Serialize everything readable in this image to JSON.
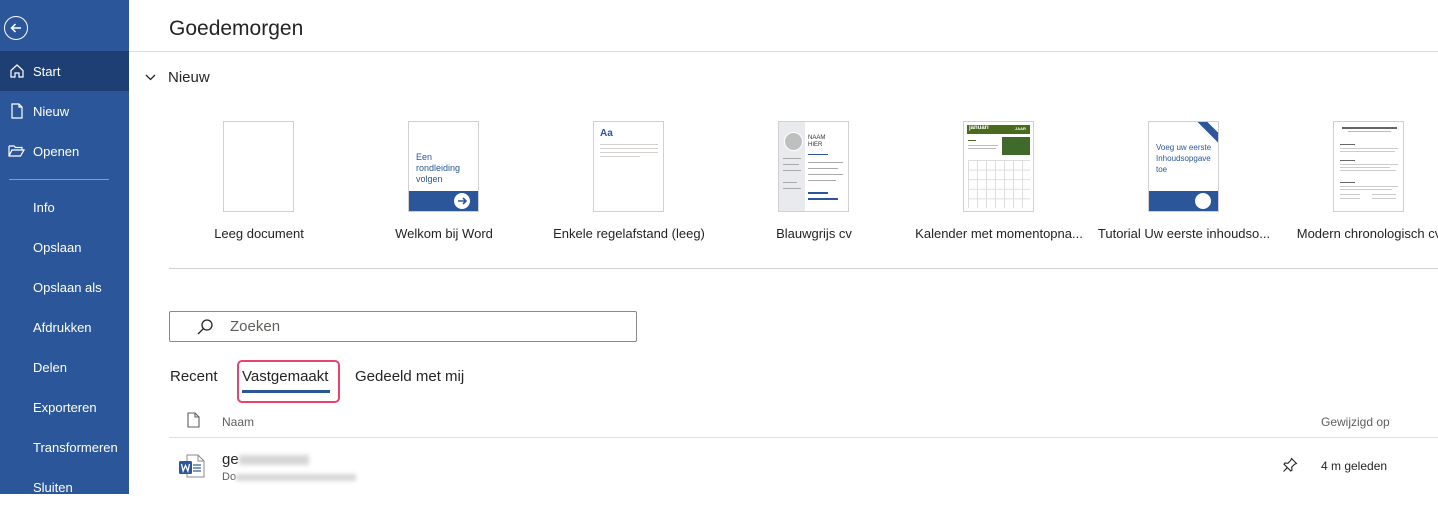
{
  "sidebar": {
    "items": [
      {
        "label": "Start",
        "icon": "home-icon"
      },
      {
        "label": "Nieuw",
        "icon": "new-document-icon"
      },
      {
        "label": "Openen",
        "icon": "folder-open-icon"
      },
      {
        "label": "Info"
      },
      {
        "label": "Opslaan"
      },
      {
        "label": "Opslaan als"
      },
      {
        "label": "Afdrukken"
      },
      {
        "label": "Delen"
      },
      {
        "label": "Exporteren"
      },
      {
        "label": "Transformeren"
      },
      {
        "label": "Sluiten"
      }
    ],
    "accent": "#2b579a",
    "active_bg": "#1e3f73"
  },
  "greeting": "Goedemorgen",
  "new_section": {
    "title": "Nieuw",
    "templates": [
      {
        "label": "Leeg document"
      },
      {
        "label": "Welkom bij Word",
        "thumb_text": "Een rondleiding volgen"
      },
      {
        "label": "Enkele regelafstand (leeg)",
        "thumb_text": "Aa"
      },
      {
        "label": "Blauwgrijs cv",
        "thumb_text": "NAAM HIER"
      },
      {
        "label": "Kalender met momentopna...",
        "thumb_text": "januari",
        "thumb_text2": "JAAR"
      },
      {
        "label": "Tutorial Uw eerste inhoudso...",
        "thumb_text": "Voeg uw eerste Inhoudsopgave toe"
      },
      {
        "label": "Modern chronologisch cv"
      }
    ]
  },
  "search": {
    "placeholder": "Zoeken"
  },
  "tabs": [
    {
      "label": "Recent"
    },
    {
      "label": "Vastgemaakt",
      "active": true
    },
    {
      "label": "Gedeeld met mij"
    }
  ],
  "list": {
    "col_name": "Naam",
    "col_modified": "Gewijzigd op",
    "rows": [
      {
        "name_prefix": "ge",
        "path_prefix": "Do",
        "modified": "4 m geleden"
      }
    ]
  },
  "highlight_color": "#e8426e"
}
